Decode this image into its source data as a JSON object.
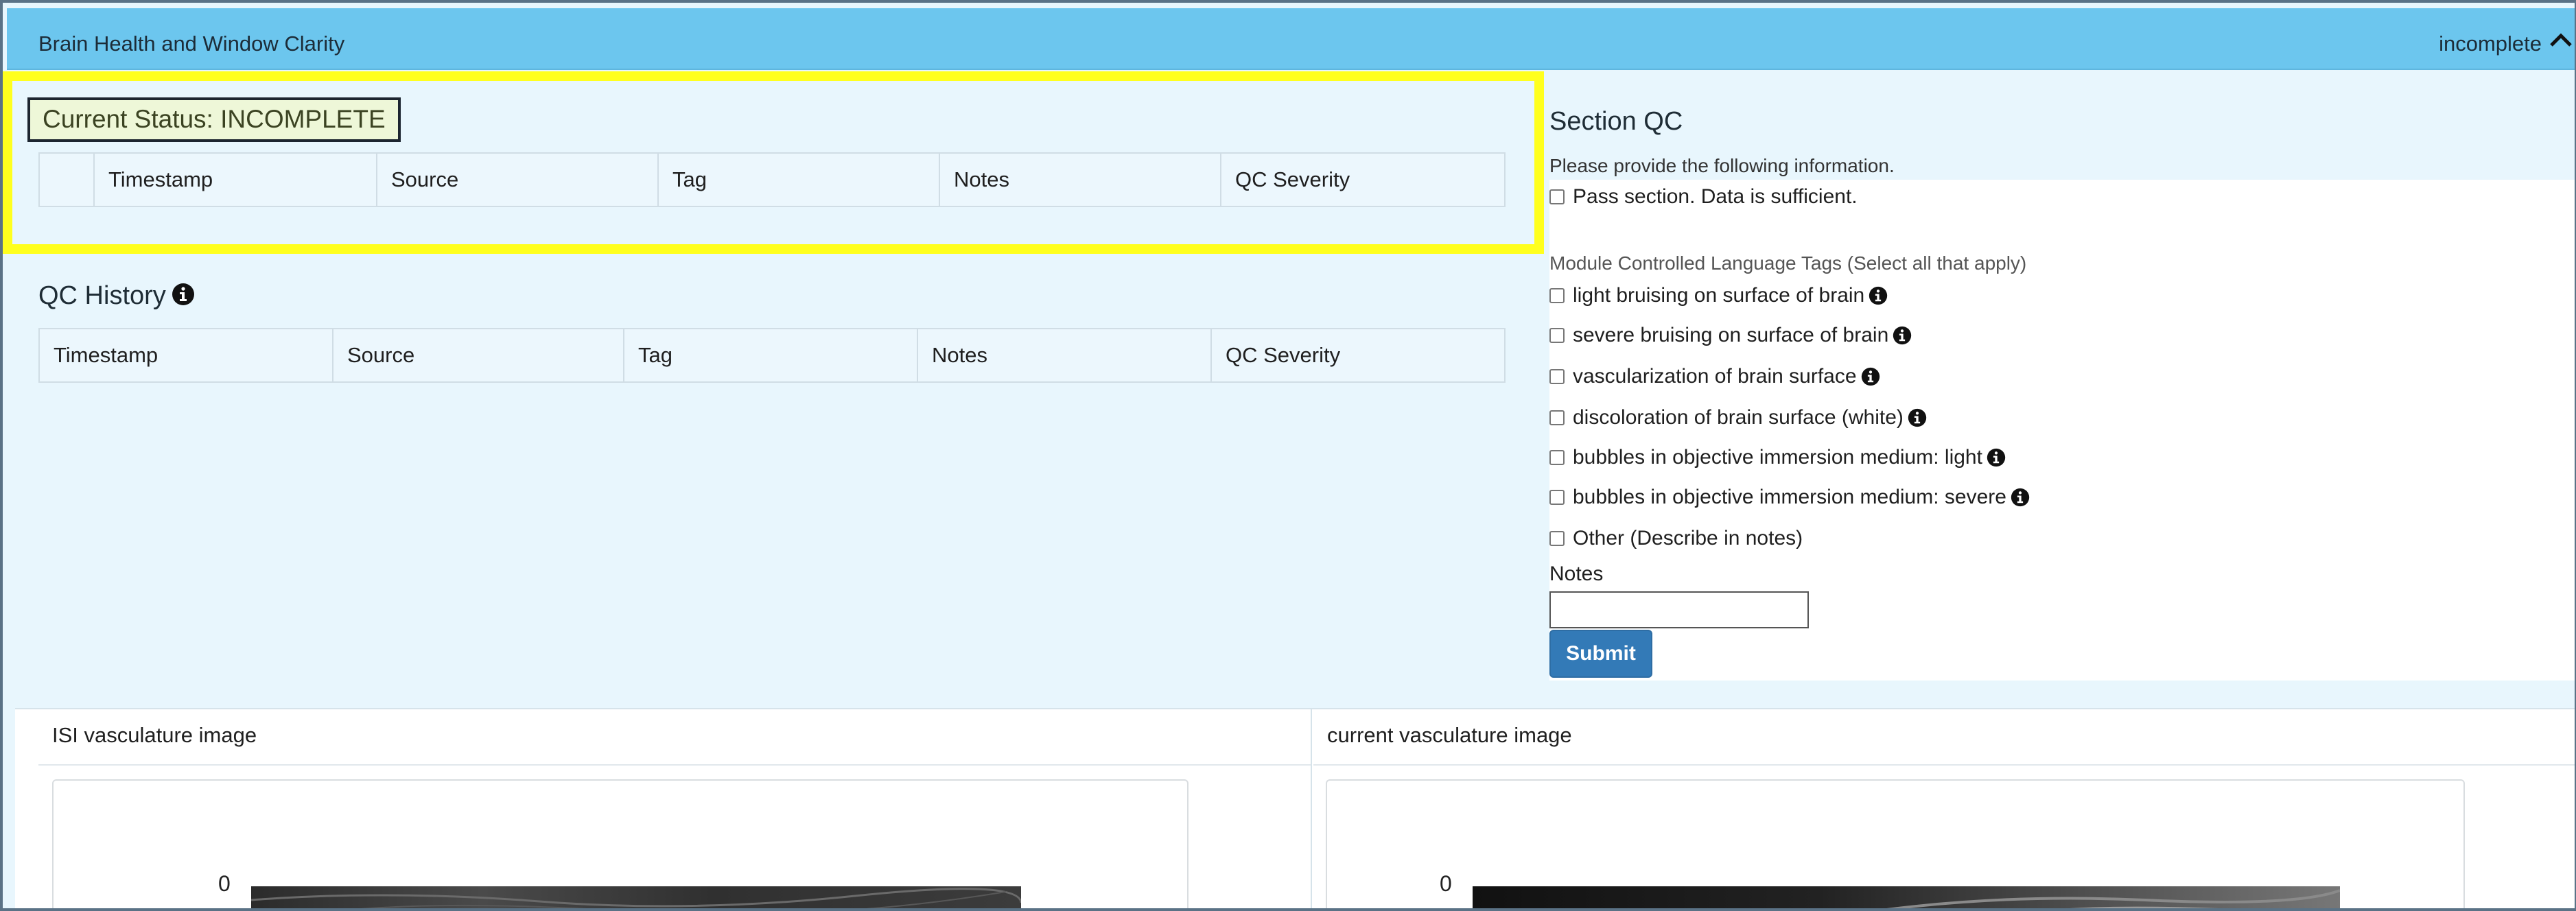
{
  "header": {
    "title": "Brain Health and Window Clarity",
    "status": "incomplete",
    "collapse_icon": "chevron-up-icon"
  },
  "current_status": {
    "label": "Current Status: INCOMPLETE",
    "columns": [
      "",
      "Timestamp",
      "Source",
      "Tag",
      "Notes",
      "QC Severity"
    ]
  },
  "qc_history": {
    "title": "QC History",
    "info_icon": "info-circle-icon",
    "columns": [
      "Timestamp",
      "Source",
      "Tag",
      "Notes",
      "QC Severity"
    ]
  },
  "section_qc": {
    "title": "Section QC",
    "prompt": "Please provide the following information.",
    "pass_label": "Pass section. Data is sufficient.",
    "tags_label": "Module Controlled Language Tags (Select all that apply)",
    "tags": [
      "light bruising on surface of brain",
      "severe bruising on surface of brain",
      "vascularization of brain surface",
      "discoloration of brain surface (white)",
      "bubbles in objective immersion medium: light",
      "bubbles in objective immersion medium: severe",
      "Other (Describe in notes)"
    ],
    "notes_label": "Notes",
    "notes_value": "",
    "submit_label": "Submit"
  },
  "images": {
    "isi_title": "ISI vasculature image",
    "current_title": "current vasculature image",
    "isi_tick": "0",
    "current_tick": "0"
  },
  "colors": {
    "header_bg": "#6cc6ee",
    "page_bg": "#e8f6fd",
    "highlight": "#ffff1e",
    "submit_bg": "#337ab7"
  }
}
